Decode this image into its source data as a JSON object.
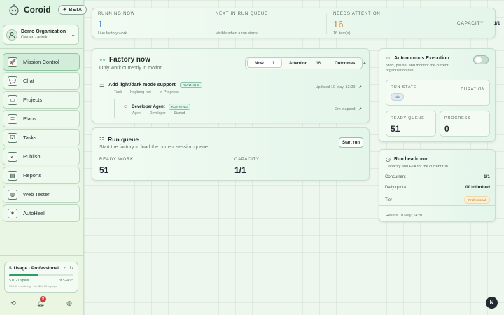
{
  "brand": {
    "name": "Coroid",
    "badge": "BETA"
  },
  "org": {
    "name": "Demo Organization",
    "role": "Owner · admin"
  },
  "nav": [
    {
      "label": "Mission Control",
      "icon": "rocket-icon",
      "glyph": "🚀",
      "active": true
    },
    {
      "label": "Chat",
      "icon": "chat-icon",
      "glyph": "💬"
    },
    {
      "label": "Projects",
      "icon": "folder-icon",
      "glyph": "▭"
    },
    {
      "label": "Plans",
      "icon": "plans-icon",
      "glyph": "≣"
    },
    {
      "label": "Tasks",
      "icon": "tasks-icon",
      "glyph": "☑"
    },
    {
      "label": "Publish",
      "icon": "publish-icon",
      "glyph": "✓"
    },
    {
      "label": "Reports",
      "icon": "reports-icon",
      "glyph": "▤"
    },
    {
      "label": "Web Tester",
      "icon": "globe-icon",
      "glyph": "◍"
    },
    {
      "label": "AutoHeal",
      "icon": "autoheal-icon",
      "glyph": "✶"
    }
  ],
  "usage": {
    "title": "Usage · Professional",
    "spent": "$11.21 spent",
    "of": "of $24.95",
    "fill": 0.45,
    "foot": "$13.69 remaining · Inc. $24.95 top-ups"
  },
  "notifications": {
    "count": "9"
  },
  "stats": [
    {
      "label": "RUNNING NOW",
      "value": "1",
      "sub": "Live factory work",
      "color": "#2a7bc0"
    },
    {
      "label": "NEXT IN RUN QUEUE",
      "value": "--",
      "sub": "Visible when a run starts",
      "color": "#2a7bc0"
    },
    {
      "label": "NEEDS ATTENTION",
      "value": "16",
      "sub": "16 item(s)",
      "color": "#d98a2b"
    }
  ],
  "capacity_top": {
    "label": "CAPACITY",
    "value": "1/1"
  },
  "factory": {
    "title": "Factory now",
    "subtitle": "Only work currently in motion.",
    "tabs": [
      {
        "label": "Now",
        "count": "1"
      },
      {
        "label": "Attention",
        "count": "16"
      },
      {
        "label": "Outcomes",
        "count": "4"
      }
    ],
    "task": {
      "title": "Add light/dark mode support",
      "status": "RUNNING",
      "type": "Task",
      "repo": "hogberg-net",
      "state": "In Progress",
      "updated": "Updated 10 May, 13:29"
    },
    "agent": {
      "title": "Developer Agent",
      "status": "RUNNING",
      "type": "Agent",
      "role": "Developer",
      "state": "Started",
      "elapsed": "2m elapsed"
    }
  },
  "queue": {
    "title": "Run queue",
    "subtitle": "Start the factory to load the current session queue.",
    "button": "Start run",
    "ready_label": "READY WORK",
    "ready_value": "51",
    "capacity_label": "CAPACITY",
    "capacity_value": "1/1"
  },
  "autonomous": {
    "title": "Autonomous Execution",
    "subtitle": "Start, pause, and monitor the current organization run.",
    "run_state_label": "RUN STATE",
    "run_state_value": "Idle",
    "duration_label": "DURATION",
    "duration_value": "--",
    "ready_queue_label": "READY QUEUE",
    "ready_queue_value": "51",
    "progress_label": "PROGRESS",
    "progress_value": "0"
  },
  "headroom": {
    "title": "Run headroom",
    "subtitle": "Capacity and ETA for the current run.",
    "rows": [
      {
        "label": "Concurrent",
        "value": "1/1"
      },
      {
        "label": "Daily quota",
        "value": "0/Unlimited"
      },
      {
        "label": "Tier",
        "value": "Professional"
      }
    ],
    "resets": "Resets 10 May, 14:31"
  },
  "fab": {
    "label": "N"
  }
}
